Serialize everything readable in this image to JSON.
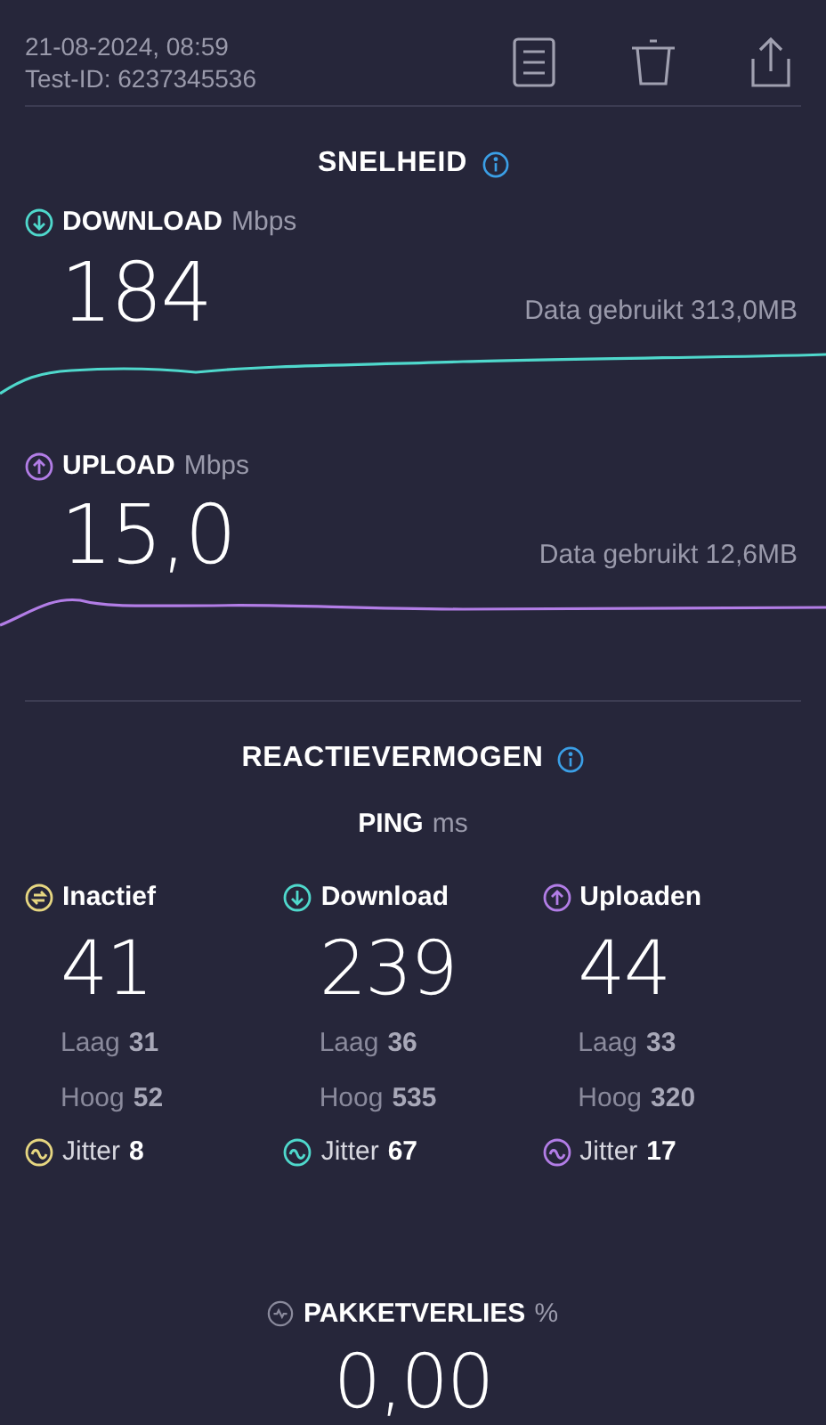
{
  "header": {
    "date": "21-08-2024, 08:59",
    "test_id": "Test-ID: 6237345536"
  },
  "speed": {
    "title": "SNELHEID",
    "metrics": [
      {
        "kind": "download",
        "label": "DOWNLOAD",
        "unit": "Mbps",
        "value": "184",
        "data_used": "Data gebruikt 313,0MB"
      },
      {
        "kind": "upload",
        "label": "UPLOAD",
        "unit": "Mbps",
        "value": "15,0",
        "data_used": "Data gebruikt 12,6MB"
      }
    ]
  },
  "responsiveness": {
    "title": "REACTIEVERMOGEN",
    "ping_label": "PING",
    "ping_unit": "ms",
    "columns": [
      {
        "kind": "idle",
        "label": "Inactief",
        "value": "41",
        "low_label": "Laag",
        "low": "31",
        "high_label": "Hoog",
        "high": "52",
        "jitter_label": "Jitter",
        "jitter": "8"
      },
      {
        "kind": "download",
        "label": "Download",
        "value": "239",
        "low_label": "Laag",
        "low": "36",
        "high_label": "Hoog",
        "high": "535",
        "jitter_label": "Jitter",
        "jitter": "67"
      },
      {
        "kind": "upload",
        "label": "Uploaden",
        "value": "44",
        "low_label": "Laag",
        "low": "33",
        "high_label": "Hoog",
        "high": "320",
        "jitter_label": "Jitter",
        "jitter": "17"
      }
    ]
  },
  "packet_loss": {
    "label": "PAKKETVERLIES",
    "unit": "%",
    "value": "0,00"
  }
}
